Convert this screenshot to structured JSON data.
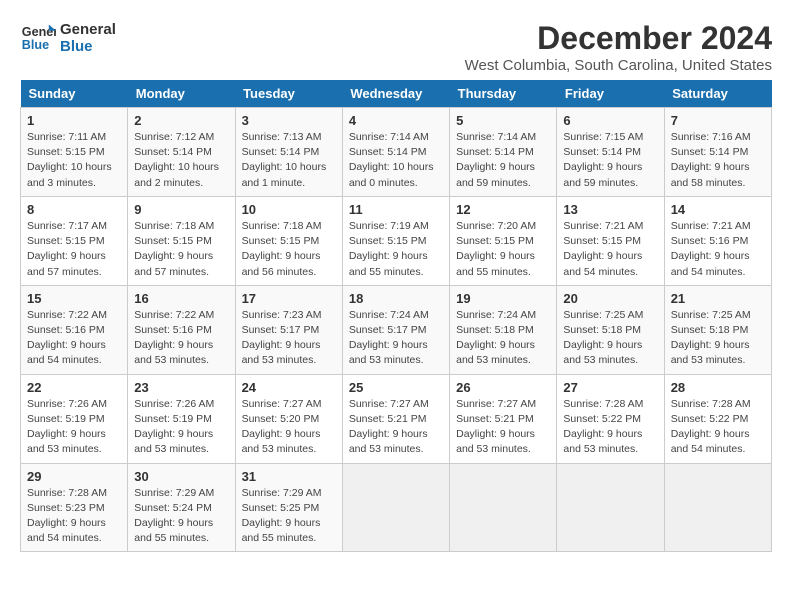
{
  "logo": {
    "line1": "General",
    "line2": "Blue"
  },
  "title": "December 2024",
  "subtitle": "West Columbia, South Carolina, United States",
  "days_header": [
    "Sunday",
    "Monday",
    "Tuesday",
    "Wednesday",
    "Thursday",
    "Friday",
    "Saturday"
  ],
  "weeks": [
    [
      {
        "day": "1",
        "info": "Sunrise: 7:11 AM\nSunset: 5:15 PM\nDaylight: 10 hours\nand 3 minutes."
      },
      {
        "day": "2",
        "info": "Sunrise: 7:12 AM\nSunset: 5:14 PM\nDaylight: 10 hours\nand 2 minutes."
      },
      {
        "day": "3",
        "info": "Sunrise: 7:13 AM\nSunset: 5:14 PM\nDaylight: 10 hours\nand 1 minute."
      },
      {
        "day": "4",
        "info": "Sunrise: 7:14 AM\nSunset: 5:14 PM\nDaylight: 10 hours\nand 0 minutes."
      },
      {
        "day": "5",
        "info": "Sunrise: 7:14 AM\nSunset: 5:14 PM\nDaylight: 9 hours\nand 59 minutes."
      },
      {
        "day": "6",
        "info": "Sunrise: 7:15 AM\nSunset: 5:14 PM\nDaylight: 9 hours\nand 59 minutes."
      },
      {
        "day": "7",
        "info": "Sunrise: 7:16 AM\nSunset: 5:14 PM\nDaylight: 9 hours\nand 58 minutes."
      }
    ],
    [
      {
        "day": "8",
        "info": "Sunrise: 7:17 AM\nSunset: 5:15 PM\nDaylight: 9 hours\nand 57 minutes."
      },
      {
        "day": "9",
        "info": "Sunrise: 7:18 AM\nSunset: 5:15 PM\nDaylight: 9 hours\nand 57 minutes."
      },
      {
        "day": "10",
        "info": "Sunrise: 7:18 AM\nSunset: 5:15 PM\nDaylight: 9 hours\nand 56 minutes."
      },
      {
        "day": "11",
        "info": "Sunrise: 7:19 AM\nSunset: 5:15 PM\nDaylight: 9 hours\nand 55 minutes."
      },
      {
        "day": "12",
        "info": "Sunrise: 7:20 AM\nSunset: 5:15 PM\nDaylight: 9 hours\nand 55 minutes."
      },
      {
        "day": "13",
        "info": "Sunrise: 7:21 AM\nSunset: 5:15 PM\nDaylight: 9 hours\nand 54 minutes."
      },
      {
        "day": "14",
        "info": "Sunrise: 7:21 AM\nSunset: 5:16 PM\nDaylight: 9 hours\nand 54 minutes."
      }
    ],
    [
      {
        "day": "15",
        "info": "Sunrise: 7:22 AM\nSunset: 5:16 PM\nDaylight: 9 hours\nand 54 minutes."
      },
      {
        "day": "16",
        "info": "Sunrise: 7:22 AM\nSunset: 5:16 PM\nDaylight: 9 hours\nand 53 minutes."
      },
      {
        "day": "17",
        "info": "Sunrise: 7:23 AM\nSunset: 5:17 PM\nDaylight: 9 hours\nand 53 minutes."
      },
      {
        "day": "18",
        "info": "Sunrise: 7:24 AM\nSunset: 5:17 PM\nDaylight: 9 hours\nand 53 minutes."
      },
      {
        "day": "19",
        "info": "Sunrise: 7:24 AM\nSunset: 5:18 PM\nDaylight: 9 hours\nand 53 minutes."
      },
      {
        "day": "20",
        "info": "Sunrise: 7:25 AM\nSunset: 5:18 PM\nDaylight: 9 hours\nand 53 minutes."
      },
      {
        "day": "21",
        "info": "Sunrise: 7:25 AM\nSunset: 5:18 PM\nDaylight: 9 hours\nand 53 minutes."
      }
    ],
    [
      {
        "day": "22",
        "info": "Sunrise: 7:26 AM\nSunset: 5:19 PM\nDaylight: 9 hours\nand 53 minutes."
      },
      {
        "day": "23",
        "info": "Sunrise: 7:26 AM\nSunset: 5:19 PM\nDaylight: 9 hours\nand 53 minutes."
      },
      {
        "day": "24",
        "info": "Sunrise: 7:27 AM\nSunset: 5:20 PM\nDaylight: 9 hours\nand 53 minutes."
      },
      {
        "day": "25",
        "info": "Sunrise: 7:27 AM\nSunset: 5:21 PM\nDaylight: 9 hours\nand 53 minutes."
      },
      {
        "day": "26",
        "info": "Sunrise: 7:27 AM\nSunset: 5:21 PM\nDaylight: 9 hours\nand 53 minutes."
      },
      {
        "day": "27",
        "info": "Sunrise: 7:28 AM\nSunset: 5:22 PM\nDaylight: 9 hours\nand 53 minutes."
      },
      {
        "day": "28",
        "info": "Sunrise: 7:28 AM\nSunset: 5:22 PM\nDaylight: 9 hours\nand 54 minutes."
      }
    ],
    [
      {
        "day": "29",
        "info": "Sunrise: 7:28 AM\nSunset: 5:23 PM\nDaylight: 9 hours\nand 54 minutes."
      },
      {
        "day": "30",
        "info": "Sunrise: 7:29 AM\nSunset: 5:24 PM\nDaylight: 9 hours\nand 55 minutes."
      },
      {
        "day": "31",
        "info": "Sunrise: 7:29 AM\nSunset: 5:25 PM\nDaylight: 9 hours\nand 55 minutes."
      },
      {
        "day": "",
        "info": ""
      },
      {
        "day": "",
        "info": ""
      },
      {
        "day": "",
        "info": ""
      },
      {
        "day": "",
        "info": ""
      }
    ]
  ]
}
